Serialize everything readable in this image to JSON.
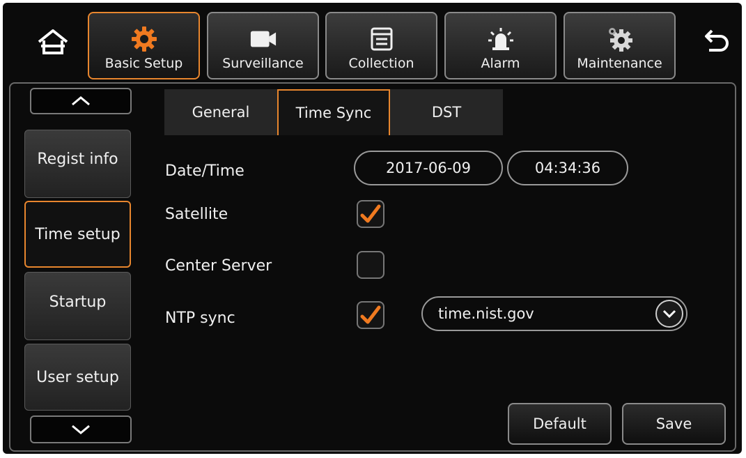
{
  "top_tabs": [
    {
      "label": "Basic Setup",
      "icon": "gear-icon",
      "active": true
    },
    {
      "label": "Surveillance",
      "icon": "camera-icon",
      "active": false
    },
    {
      "label": "Collection",
      "icon": "collection-icon",
      "active": false
    },
    {
      "label": "Alarm",
      "icon": "alarm-icon",
      "active": false
    },
    {
      "label": "Maintenance",
      "icon": "maintenance-icon",
      "active": false
    }
  ],
  "sidebar": {
    "items": [
      {
        "label": "Regist info"
      },
      {
        "label": "Time setup"
      },
      {
        "label": "Startup"
      },
      {
        "label": "User setup"
      }
    ]
  },
  "subtabs": [
    {
      "label": "General"
    },
    {
      "label": "Time Sync"
    },
    {
      "label": "DST"
    }
  ],
  "form": {
    "datetime_label": "Date/Time",
    "date_value": "2017-06-09",
    "time_value": "04:34:36",
    "satellite_label": "Satellite",
    "satellite_checked": true,
    "center_server_label": "Center Server",
    "center_server_checked": false,
    "ntp_label": "NTP sync",
    "ntp_checked": true,
    "ntp_server": "time.nist.gov"
  },
  "actions": {
    "default_label": "Default",
    "save_label": "Save"
  },
  "colors": {
    "accent": "#e8862e",
    "background": "#0b0b0b"
  }
}
